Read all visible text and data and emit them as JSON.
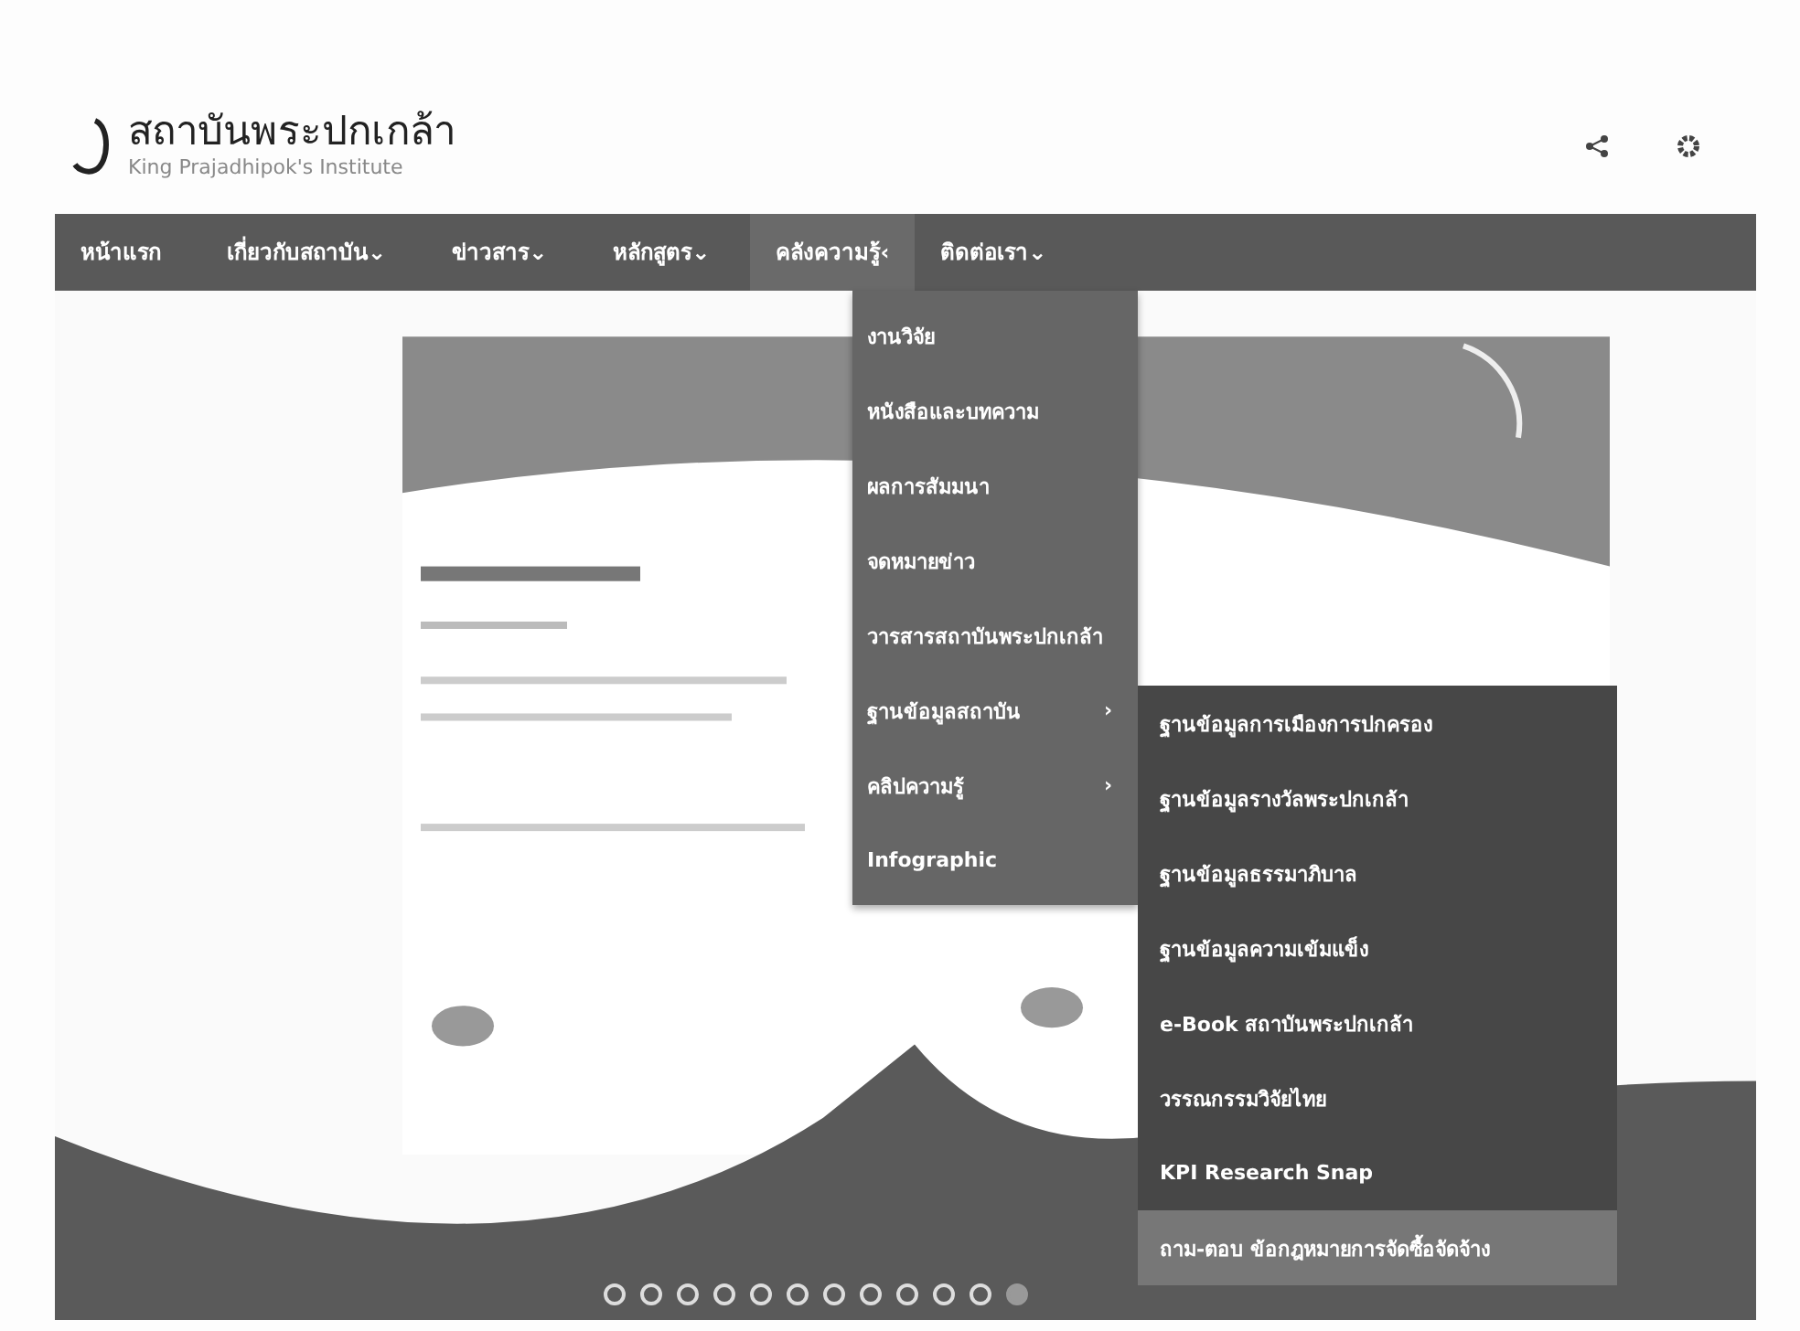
{
  "header": {
    "logo_title": "สถาบันพระปกเกล้า",
    "logo_subtitle": "King Prajadhipok's Institute"
  },
  "nav": [
    {
      "label": "หน้าแรก",
      "selected": false
    },
    {
      "label": "เกี่ยวกับสถาบัน",
      "caret": "⌄",
      "selected": false
    },
    {
      "label": "ข่าวสาร",
      "caret": "⌄",
      "selected": false
    },
    {
      "label": "หลักสูตร",
      "caret": "⌄",
      "selected": false
    },
    {
      "label": "คลังความรู้",
      "caret": "‹",
      "selected": true
    },
    {
      "label": "ติดต่อเรา",
      "caret": "⌄",
      "selected": false
    }
  ],
  "dropdown": [
    {
      "label": "งานวิจัย",
      "kind": "link"
    },
    {
      "label": "หนังสือและบทความ",
      "kind": "link"
    },
    {
      "label": "ผลการสัมมนา",
      "kind": "link"
    },
    {
      "label": "จดหมายข่าว",
      "kind": "link"
    },
    {
      "label": "วารสารสถาบันพระปกเกล้า",
      "kind": "link"
    },
    {
      "label": "ฐานข้อมูลสถาบัน",
      "kind": "submenu",
      "arrow": "›"
    },
    {
      "label": "คลิปความรู้",
      "kind": "submenu",
      "arrow": "›"
    },
    {
      "label": "Infographic",
      "kind": "link"
    }
  ],
  "submenu": [
    {
      "label": "ฐานข้อมูลการเมืองการปกครอง",
      "selected": false
    },
    {
      "label": "ฐานข้อมูลรางวัลพระปกเกล้า",
      "selected": false
    },
    {
      "label": "ฐานข้อมูลธรรมาภิบาล",
      "selected": false
    },
    {
      "label": "ฐานข้อมูลความเข้มแข็ง",
      "selected": false
    },
    {
      "label": "e-Book สถาบันพระปกเกล้า",
      "selected": false
    },
    {
      "label": "วรรณกรรมวิจัยไทย",
      "selected": false
    },
    {
      "label": "KPI Research Snap",
      "selected": false
    },
    {
      "label": "ถาม-ตอบ ข้อกฎหมายการจัดซื้อจัดจ้าง",
      "selected": true
    }
  ],
  "slider": {
    "dots": [
      {
        "selected": false
      },
      {
        "selected": false
      },
      {
        "selected": false
      },
      {
        "selected": false
      },
      {
        "selected": false
      },
      {
        "selected": false
      },
      {
        "selected": false
      },
      {
        "selected": false
      },
      {
        "selected": false
      },
      {
        "selected": false
      },
      {
        "selected": false
      },
      {
        "selected": true
      }
    ]
  }
}
